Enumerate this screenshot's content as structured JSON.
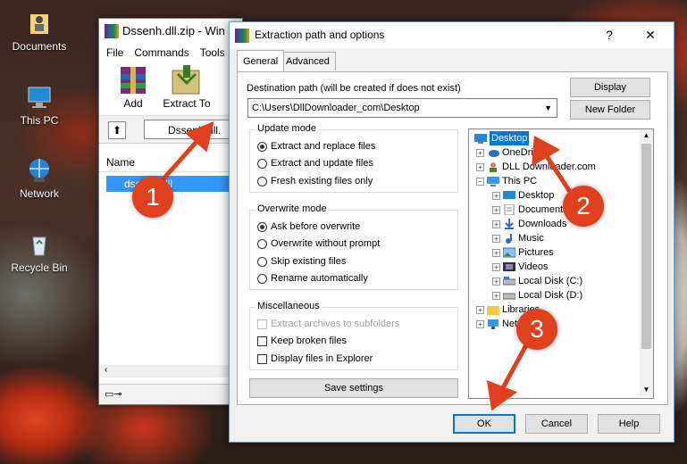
{
  "desktop": {
    "icons": [
      {
        "label": "Documents",
        "icon": "folder-icon"
      },
      {
        "label": "This PC",
        "icon": "computer-icon"
      },
      {
        "label": "Network",
        "icon": "network-icon"
      },
      {
        "label": "Recycle Bin",
        "icon": "recycle-bin-icon"
      }
    ]
  },
  "main_window": {
    "title": "Dssenh.dll.zip - Win",
    "menu": [
      "File",
      "Commands",
      "Tools"
    ],
    "toolbar": {
      "add_label": "Add",
      "extract_label": "Extract To"
    },
    "address": "Dssenh.dll.",
    "list_header": "Name",
    "selected_file": "dssenh.dll"
  },
  "dialog": {
    "title": "Extraction path and options",
    "help_glyph": "?",
    "close_glyph": "✕",
    "tabs": [
      "General",
      "Advanced"
    ],
    "dest_label": "Destination path (will be created if does not exist)",
    "dest_value": "C:\\Users\\DllDownloader_com\\Desktop",
    "display_button": "Display",
    "new_folder_button": "New Folder",
    "update_mode": {
      "title": "Update mode",
      "options": [
        "Extract and replace files",
        "Extract and update files",
        "Fresh existing files only"
      ],
      "selected": 0
    },
    "overwrite_mode": {
      "title": "Overwrite mode",
      "options": [
        "Ask before overwrite",
        "Overwrite without prompt",
        "Skip existing files",
        "Rename automatically"
      ],
      "selected": 0
    },
    "misc": {
      "title": "Miscellaneous",
      "options": [
        "Extract archives to subfolders",
        "Keep broken files",
        "Display files in Explorer"
      ]
    },
    "save_settings": "Save settings",
    "tree": [
      {
        "label": "Desktop",
        "icon": "desktop-icon",
        "selected": true
      },
      {
        "label": "OneDrive",
        "icon": "onedrive-icon"
      },
      {
        "label": "DLL Downloader.com",
        "icon": "user-icon"
      },
      {
        "label": "This PC",
        "icon": "computer-icon"
      },
      {
        "label": "Desktop",
        "icon": "desktop-icon"
      },
      {
        "label": "Documents",
        "icon": "documents-icon"
      },
      {
        "label": "Downloads",
        "icon": "downloads-icon"
      },
      {
        "label": "Music",
        "icon": "music-icon"
      },
      {
        "label": "Pictures",
        "icon": "pictures-icon"
      },
      {
        "label": "Videos",
        "icon": "videos-icon"
      },
      {
        "label": "Local Disk (C:)",
        "icon": "drive-icon"
      },
      {
        "label": "Local Disk (D:)",
        "icon": "drive-icon"
      },
      {
        "label": "Libraries",
        "icon": "folder-icon"
      },
      {
        "label": "Network",
        "icon": "network-icon"
      }
    ],
    "ok_button": "OK",
    "cancel_button": "Cancel",
    "help_button": "Help"
  },
  "steps": [
    "1",
    "2",
    "3"
  ],
  "colors": {
    "accent": "#0078d7",
    "step_badge": "#e0401e"
  }
}
